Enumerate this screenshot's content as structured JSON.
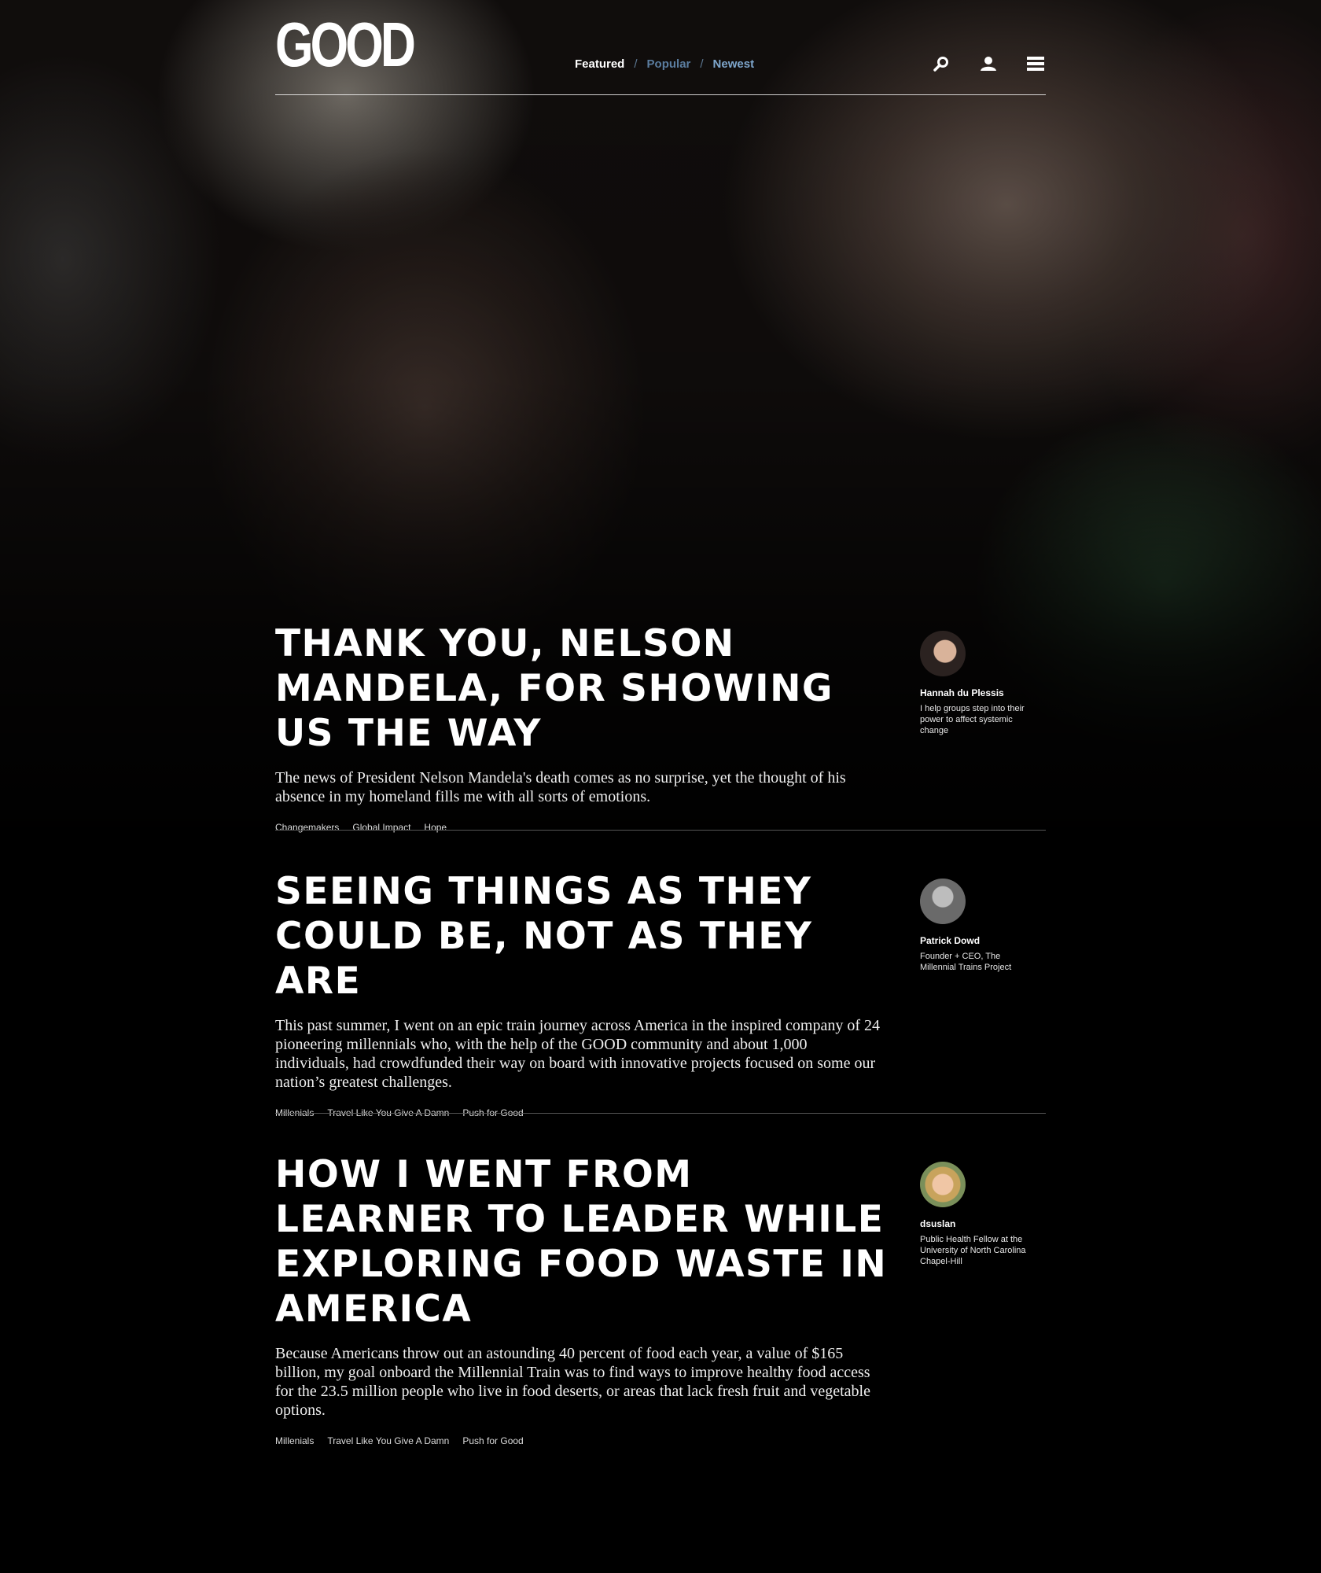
{
  "header": {
    "logo": "GOOD",
    "nav": [
      {
        "label": "Featured"
      },
      {
        "label": "Popular"
      },
      {
        "label": "Newest"
      }
    ],
    "nav_separator": "/",
    "icons": [
      "search-icon",
      "user-icon",
      "menu-icon"
    ]
  },
  "articles": [
    {
      "title": "Thank you, Nelson Mandela, for showing us the way",
      "excerpt": "The news of President Nelson Mandela's death comes as no surprise, yet the thought of his absence in my homeland fills me with all sorts of emotions.",
      "tags": [
        "Changemakers",
        "Global Impact",
        "Hope"
      ],
      "author": {
        "name": "Hannah du Plessis",
        "bio": "I help groups step into their power to affect systemic change"
      }
    },
    {
      "title": "Seeing things as they could be, not as they are",
      "excerpt": "This past summer, I went on an epic train journey across America in the inspired company of 24 pioneering millennials who, with the help of the GOOD community and about 1,000 individuals, had crowdfunded their way on board with innovative projects focused on some our nation’s greatest challenges.",
      "tags": [
        "Millenials",
        "Travel Like You Give A Damn",
        "Push for Good"
      ],
      "author": {
        "name": "Patrick Dowd",
        "bio": "Founder + CEO, The Millennial Trains Project"
      }
    },
    {
      "title": "How I went from learner to leader while exploring food waste in America",
      "excerpt": "Because Americans throw out an astounding 40 percent of food each year, a value of $165 billion, my goal onboard the Millennial Train was to find ways to improve healthy food access for the 23.5 million people who live in food deserts, or areas that lack fresh fruit and vegetable options.",
      "tags": [
        "Millenials",
        "Travel Like You Give A Damn",
        "Push for Good"
      ],
      "author": {
        "name": "dsuslan",
        "bio": "Public Health Fellow at the University of North Carolina Chapel-Hill"
      }
    }
  ],
  "colors": {
    "background": "#000000",
    "text": "#ffffff",
    "nav_active": "#ffffff",
    "nav_inactive": "#5b7da0",
    "nav_newest": "#7ea6cc"
  }
}
